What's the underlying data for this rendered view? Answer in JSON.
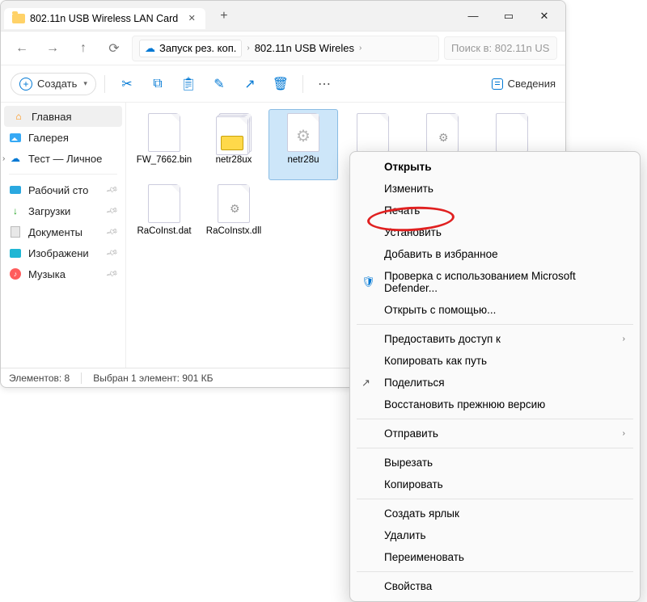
{
  "tab": {
    "title": "802.11n USB Wireless LAN Card"
  },
  "address": {
    "backup_label": "Запуск рез. коп.",
    "crumb1": "802.11n USB Wireles"
  },
  "search": {
    "placeholder": "Поиск в: 802.11n US"
  },
  "toolbar": {
    "create": "Создать",
    "details": "Сведения"
  },
  "sidebar": {
    "home": "Главная",
    "gallery": "Галерея",
    "personal": "Тест — Личное",
    "desktop": "Рабочий сто",
    "downloads": "Загрузки",
    "documents": "Документы",
    "pictures": "Изображени",
    "music": "Музыка"
  },
  "files": [
    {
      "name": "FW_7662.bin",
      "type": "blank"
    },
    {
      "name": "netr28ux",
      "type": "stack-printer"
    },
    {
      "name": "netr28u",
      "type": "gear",
      "selected": true
    },
    {
      "name": "",
      "type": "blank"
    },
    {
      "name": "",
      "type": "gear-small"
    },
    {
      "name": "",
      "type": "blank"
    },
    {
      "name": "RaCoInst.dat",
      "type": "blank"
    },
    {
      "name": "RaCoInstx.dll",
      "type": "gear-small"
    }
  ],
  "status": {
    "count": "Элементов: 8",
    "selection": "Выбран 1 элемент: 901 КБ"
  },
  "ctx": {
    "open": "Открыть",
    "edit": "Изменить",
    "print": "Печать",
    "install": "Установить",
    "favorite": "Добавить в избранное",
    "defender": "Проверка с использованием Microsoft Defender...",
    "openwith": "Открыть с помощью...",
    "share_access": "Предоставить доступ к",
    "copy_path": "Копировать как путь",
    "share": "Поделиться",
    "restore": "Восстановить прежнюю версию",
    "send_to": "Отправить",
    "cut": "Вырезать",
    "copy": "Копировать",
    "shortcut": "Создать ярлык",
    "delete": "Удалить",
    "rename": "Переименовать",
    "properties": "Свойства"
  }
}
